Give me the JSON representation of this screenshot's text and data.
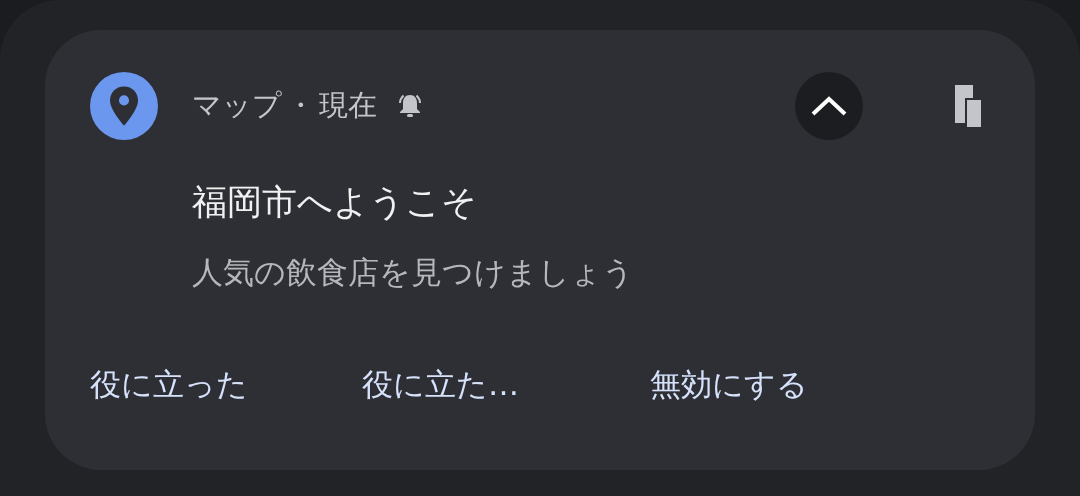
{
  "notification": {
    "app": "マップ",
    "separator": "・",
    "time": "現在",
    "alerting": true,
    "expanded": true,
    "title": "福岡市へようこそ",
    "body": "人気の飲食店を見つけましょう",
    "actions": [
      "役に立った",
      "役に立た…",
      "無効にする"
    ]
  }
}
